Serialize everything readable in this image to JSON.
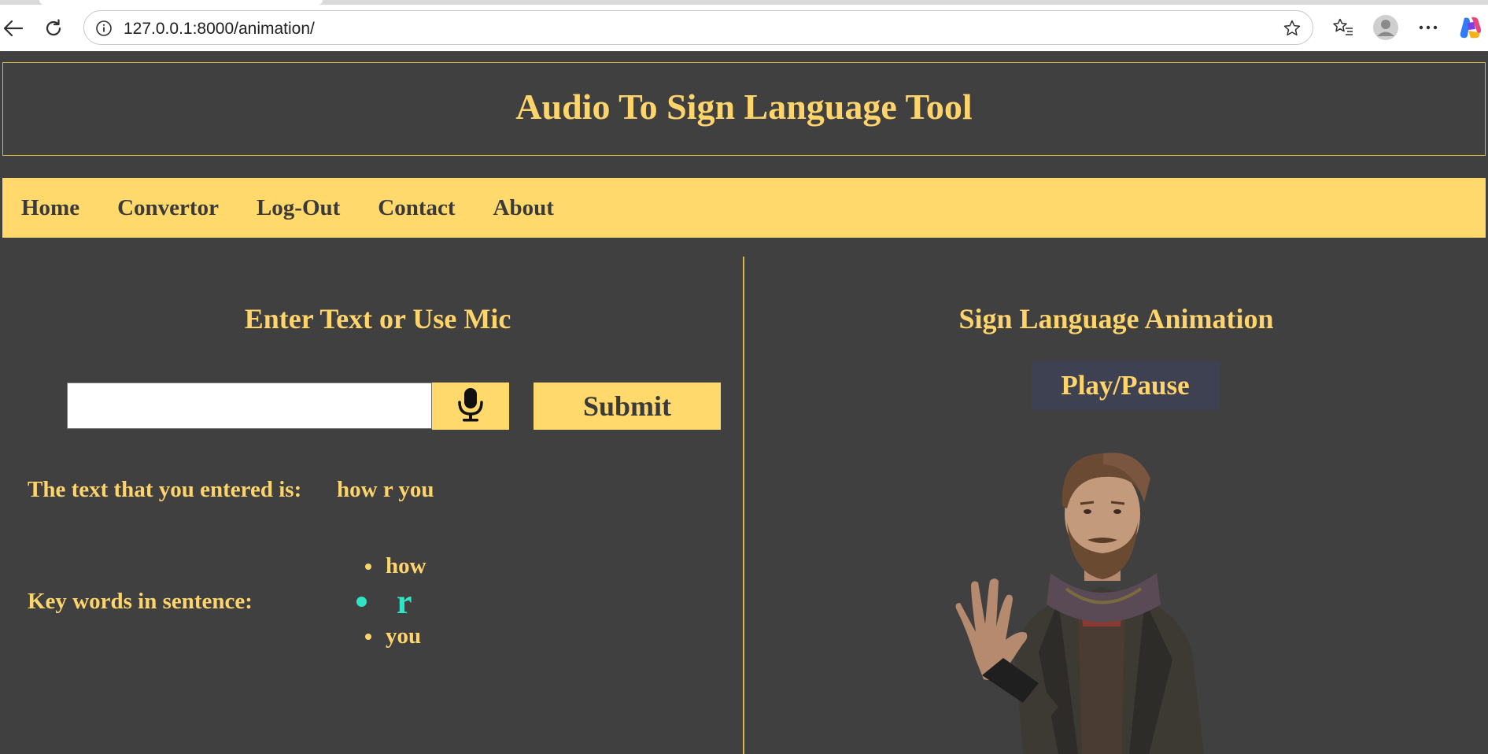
{
  "browser": {
    "url": "127.0.0.1:8000/animation/",
    "icons": [
      "back-arrow-icon",
      "refresh-icon",
      "info-icon",
      "star-icon",
      "favorites-icon",
      "profile-icon",
      "more-icon",
      "copilot-icon"
    ]
  },
  "header": {
    "title": "Audio To Sign Language Tool"
  },
  "nav": {
    "home": "Home",
    "convertor": "Convertor",
    "logout": "Log-Out",
    "contact": "Contact",
    "about": "About"
  },
  "left": {
    "title": "Enter Text or Use Mic",
    "input_value": "",
    "submit_label": "Submit",
    "entered_label": "The text that you entered is:",
    "entered_value": "how r you",
    "keywords_label": "Key words in sentence:",
    "keywords": [
      "how",
      "r",
      "you"
    ],
    "active_keyword_index": 1
  },
  "right": {
    "title": "Sign Language Animation",
    "play_label": "Play/Pause"
  },
  "colors": {
    "background": "#404040",
    "accent": "#ffd96b",
    "active_keyword": "#2ee6c4",
    "play_button": "#3d4152"
  }
}
